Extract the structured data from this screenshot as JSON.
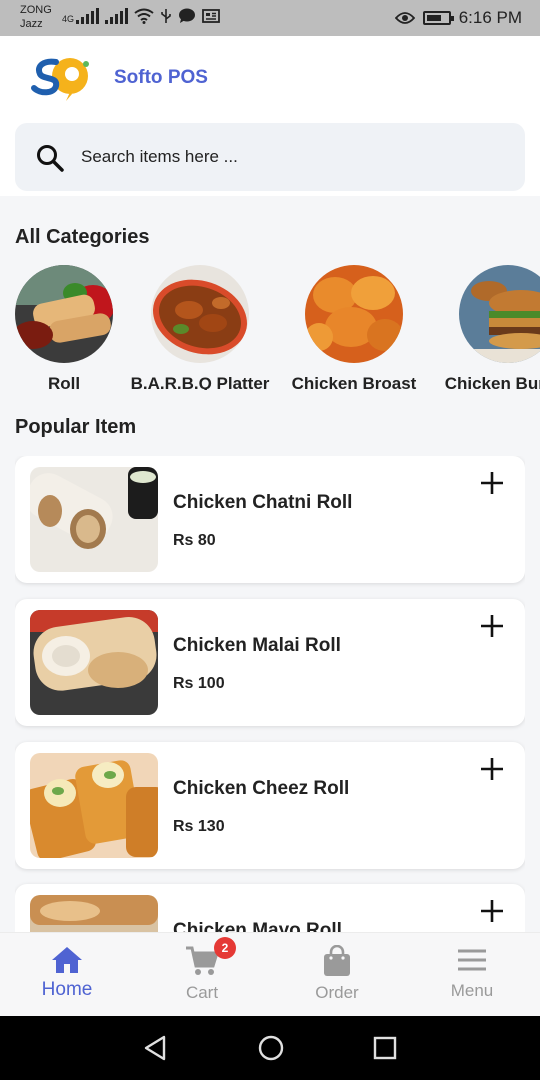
{
  "status_bar": {
    "carrier_line1": "ZONG",
    "carrier_line2": "Jazz",
    "network_type": "4G",
    "time": "6:16 PM",
    "icons": [
      "signal-icon",
      "wifi-icon",
      "usb-icon",
      "chat-icon",
      "news-icon",
      "eye-icon",
      "battery-icon"
    ]
  },
  "header": {
    "app_title": "Softo POS",
    "logo_text": "SP"
  },
  "search": {
    "placeholder": "Search items here ..."
  },
  "categories": {
    "title": "All Categories",
    "items": [
      {
        "label": "Roll"
      },
      {
        "label": "B.A.R.B.Q Platter"
      },
      {
        "label": "Chicken Broast"
      },
      {
        "label": "Chicken Burger"
      }
    ]
  },
  "popular": {
    "title": "Popular Item",
    "items": [
      {
        "name": "Chicken Chatni Roll",
        "price": "Rs 80"
      },
      {
        "name": "Chicken Malai Roll",
        "price": "Rs 100"
      },
      {
        "name": "Chicken Cheez Roll",
        "price": "Rs 130"
      },
      {
        "name": "Chicken Mayo Roll",
        "price": ""
      }
    ]
  },
  "bottom_nav": {
    "items": [
      {
        "label": "Home",
        "active": true
      },
      {
        "label": "Cart",
        "badge": "2"
      },
      {
        "label": "Order"
      },
      {
        "label": "Menu"
      }
    ]
  },
  "colors": {
    "accent": "#4f63d2",
    "badge": "#e53935",
    "inactive_nav": "#9a9a9a"
  }
}
